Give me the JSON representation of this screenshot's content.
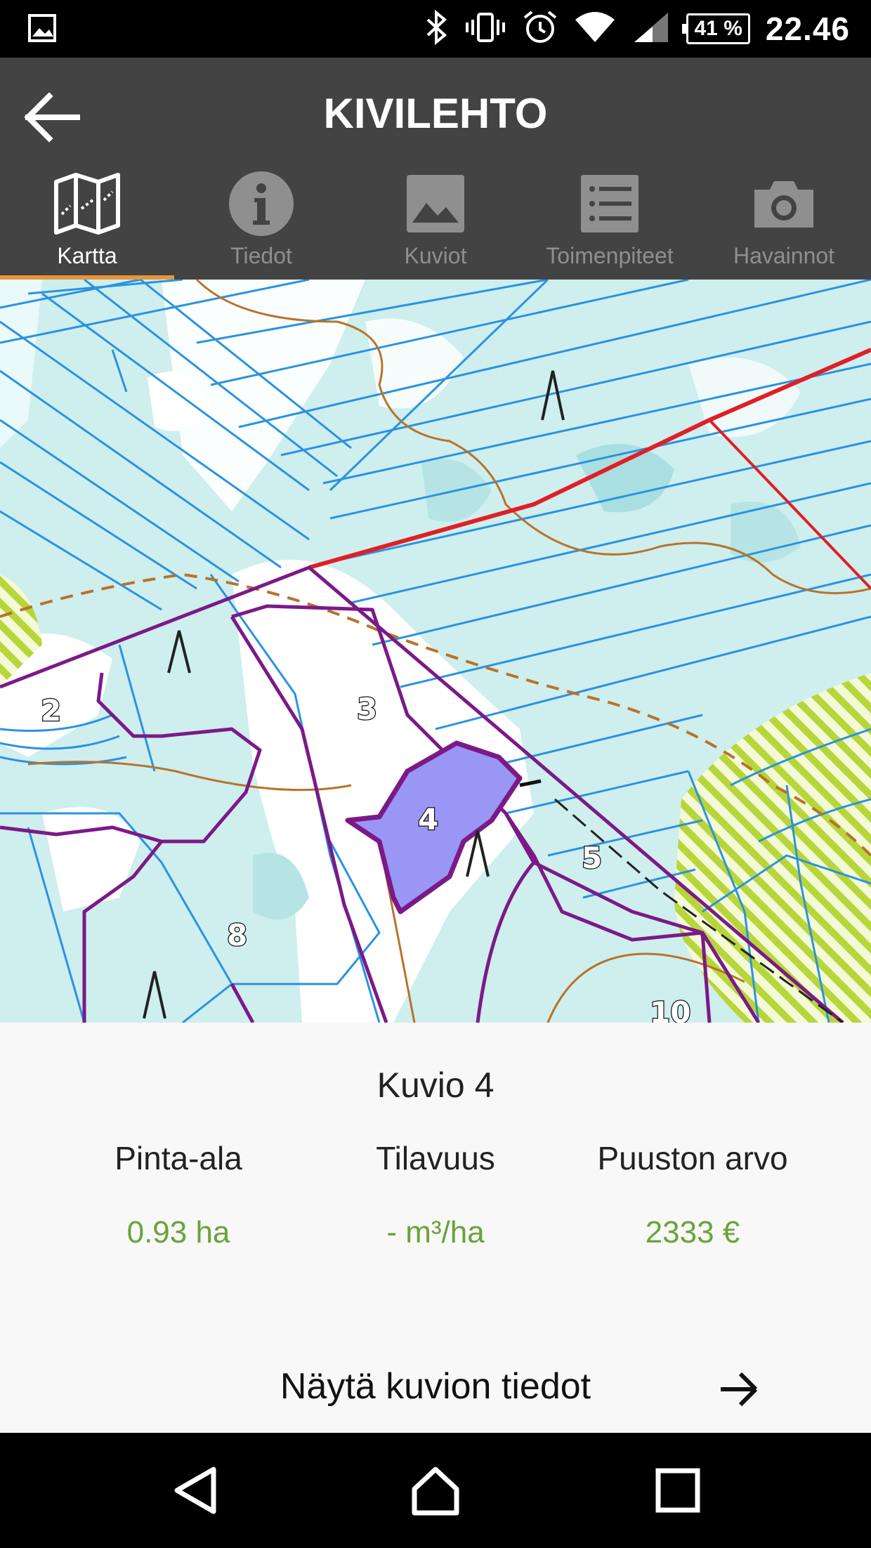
{
  "status_bar": {
    "battery": "41 %",
    "time": "22.46",
    "icons": [
      "image-icon",
      "bluetooth-icon",
      "vibrate-icon",
      "alarm-icon",
      "wifi-icon",
      "signal-icon",
      "battery-icon"
    ]
  },
  "header": {
    "title": "KIVILEHTO",
    "back_icon": "arrow-left-icon"
  },
  "tabs": [
    {
      "label": "Kartta",
      "icon": "map-icon",
      "active": true
    },
    {
      "label": "Tiedot",
      "icon": "info-icon",
      "active": false
    },
    {
      "label": "Kuviot",
      "icon": "image-icon",
      "active": false
    },
    {
      "label": "Toimenpiteet",
      "icon": "list-icon",
      "active": false
    },
    {
      "label": "Havainnot",
      "icon": "camera-icon",
      "active": false
    }
  ],
  "colors": {
    "header_bg": "#434343",
    "active_tab_indicator": "#e8943a",
    "value_green": "#6aa33a",
    "selected_parcel": "#9a96f5",
    "parcel_border": "#7b1a87",
    "property_border": "#e01f26"
  },
  "map": {
    "parcel_labels": [
      "2",
      "3",
      "4",
      "5",
      "8",
      "10"
    ],
    "selected_parcel": "4"
  },
  "info": {
    "title": "Kuvio 4",
    "stats": [
      {
        "label": "Pinta-ala",
        "value": "0.93 ha"
      },
      {
        "label": "Tilavuus",
        "value": "- m³/ha"
      },
      {
        "label": "Puuston arvo",
        "value": "2333 €"
      }
    ],
    "details_link": "Näytä kuvion tiedot"
  },
  "nav": {
    "icons": [
      "nav-back-icon",
      "nav-home-icon",
      "nav-recent-icon"
    ]
  }
}
